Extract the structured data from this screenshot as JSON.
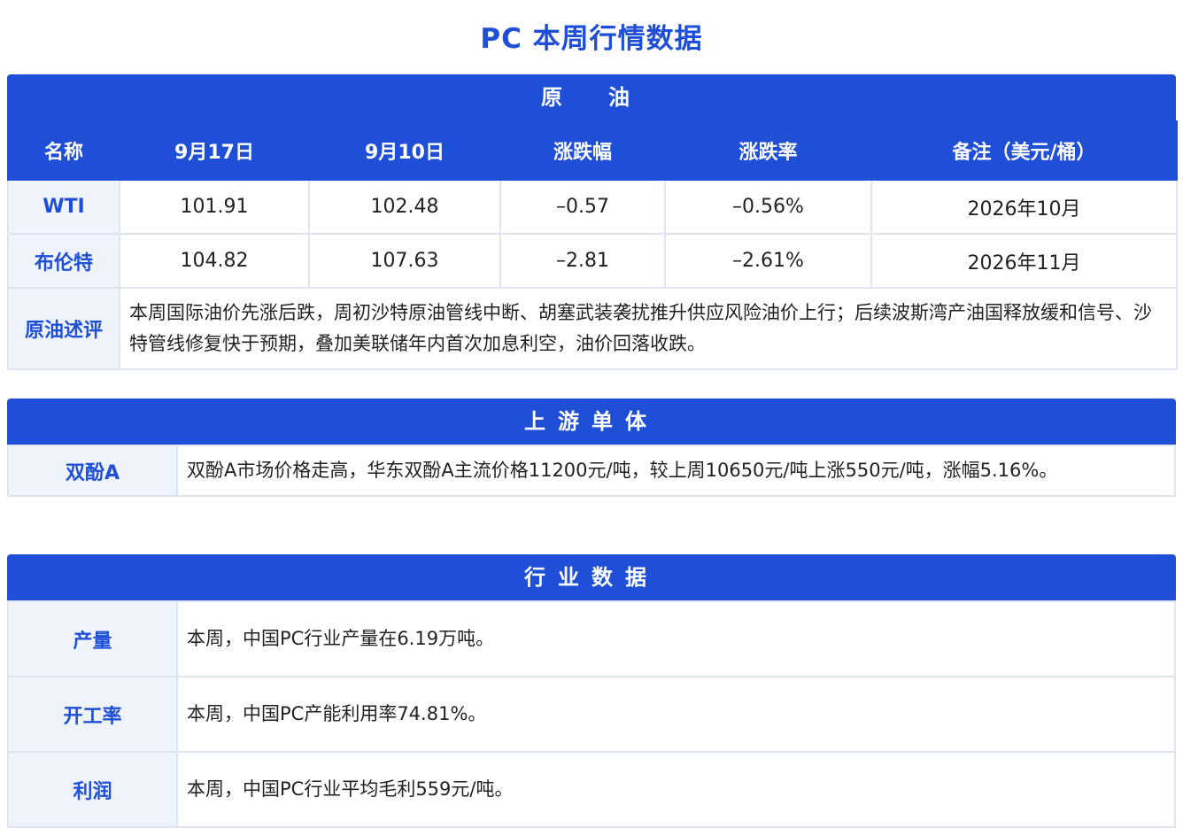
{
  "page_title": "PC 本周行情数据",
  "crude": {
    "heading": "原　油",
    "columns": [
      "名称",
      "9月17日",
      "9月10日",
      "涨跌幅",
      "涨跌率",
      "备注（美元/桶）"
    ],
    "rows": [
      [
        "WTI",
        "101.91",
        "102.48",
        "–0.57",
        "–0.56%",
        "2026年10月"
      ],
      [
        "布伦特",
        "104.82",
        "107.63",
        "–2.81",
        "–2.61%",
        "2026年11月"
      ]
    ],
    "comment_label": "原油述评",
    "comment_text": "本周国际油价先涨后跌，周初沙特原油管线中断、胡塞武装袭扰推升供应风险油价上行；后续波斯湾产油国释放缓和信号、沙特管线修复快于预期，叠加美联储年内首次加息利空，油价回落收跌。"
  },
  "upstream": {
    "heading": "上游单体",
    "label": "双酚A",
    "text": "双酚A市场价格走高，华东双酚A主流价格11200元/吨，较上周10650元/吨上涨550元/吨，涨幅5.16%。"
  },
  "industry": {
    "heading": "行业数据",
    "rows": [
      {
        "label": "产量",
        "text": "本周，中国PC行业产量在6.19万吨。"
      },
      {
        "label": "开工率",
        "text": "本周，中国PC产能利用率74.81%。"
      },
      {
        "label": "利润",
        "text": "本周，中国PC行业平均毛利559元/吨。"
      }
    ]
  },
  "colors": {
    "accent": "#1f4fd6",
    "label_bg": "#eef3fc",
    "border": "#dfe4ee"
  }
}
